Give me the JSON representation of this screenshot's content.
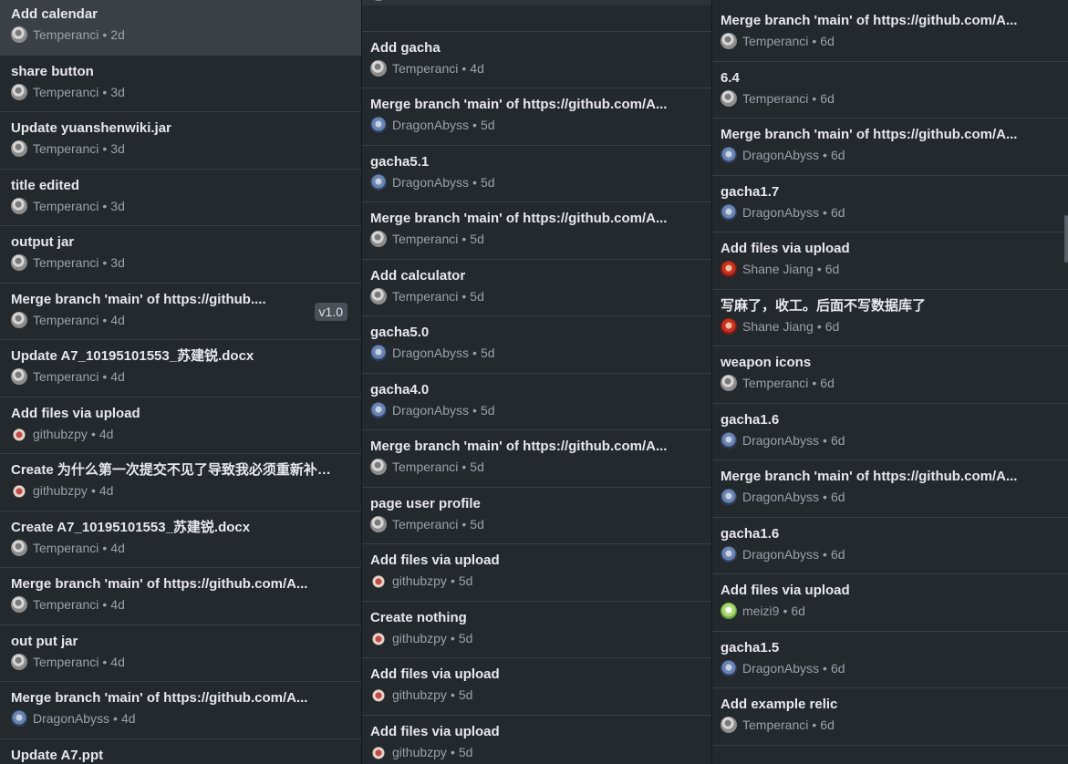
{
  "columns": [
    {
      "items": [
        {
          "title": "Add calendar",
          "author": "Temperanci",
          "time": "2d",
          "avatar": "temperanci",
          "selected": true
        },
        {
          "title": "share button",
          "author": "Temperanci",
          "time": "3d",
          "avatar": "temperanci"
        },
        {
          "title": "Update yuanshenwiki.jar",
          "author": "Temperanci",
          "time": "3d",
          "avatar": "temperanci"
        },
        {
          "title": "title edited",
          "author": "Temperanci",
          "time": "3d",
          "avatar": "temperanci"
        },
        {
          "title": "output jar",
          "author": "Temperanci",
          "time": "3d",
          "avatar": "temperanci"
        },
        {
          "title": "Merge branch 'main' of https://github....",
          "author": "Temperanci",
          "time": "4d",
          "avatar": "temperanci",
          "tag": "v1.0"
        },
        {
          "title": "Update A7_10195101553_苏建锐.docx",
          "author": "Temperanci",
          "time": "4d",
          "avatar": "temperanci"
        },
        {
          "title": "Add files via upload",
          "author": "githubzpy",
          "time": "4d",
          "avatar": "github"
        },
        {
          "title": "Create 为什么第一次提交不见了导致我必须重新补一...",
          "author": "githubzpy",
          "time": "4d",
          "avatar": "github"
        },
        {
          "title": "Create A7_10195101553_苏建锐.docx",
          "author": "Temperanci",
          "time": "4d",
          "avatar": "temperanci"
        },
        {
          "title": "Merge branch 'main' of https://github.com/A...",
          "author": "Temperanci",
          "time": "4d",
          "avatar": "temperanci"
        },
        {
          "title": "out put jar",
          "author": "Temperanci",
          "time": "4d",
          "avatar": "temperanci"
        },
        {
          "title": "Merge branch 'main' of https://github.com/A...",
          "author": "DragonAbyss",
          "time": "4d",
          "avatar": "dragon"
        },
        {
          "title": "Update A7.ppt",
          "author": "",
          "time": "",
          "avatar": ""
        }
      ]
    },
    {
      "items": [
        {
          "title": "",
          "author": "Temperanci",
          "time": "4d",
          "avatar": "temperanci"
        },
        {
          "title": "Add gacha",
          "author": "Temperanci",
          "time": "4d",
          "avatar": "temperanci"
        },
        {
          "title": "Merge branch 'main' of https://github.com/A...",
          "author": "DragonAbyss",
          "time": "5d",
          "avatar": "dragon"
        },
        {
          "title": "gacha5.1",
          "author": "DragonAbyss",
          "time": "5d",
          "avatar": "dragon"
        },
        {
          "title": "Merge branch 'main' of https://github.com/A...",
          "author": "Temperanci",
          "time": "5d",
          "avatar": "temperanci"
        },
        {
          "title": "Add calculator",
          "author": "Temperanci",
          "time": "5d",
          "avatar": "temperanci"
        },
        {
          "title": "gacha5.0",
          "author": "DragonAbyss",
          "time": "5d",
          "avatar": "dragon"
        },
        {
          "title": "gacha4.0",
          "author": "DragonAbyss",
          "time": "5d",
          "avatar": "dragon"
        },
        {
          "title": "Merge branch 'main' of https://github.com/A...",
          "author": "Temperanci",
          "time": "5d",
          "avatar": "temperanci"
        },
        {
          "title": "page user profile",
          "author": "Temperanci",
          "time": "5d",
          "avatar": "temperanci"
        },
        {
          "title": "Add files via upload",
          "author": "githubzpy",
          "time": "5d",
          "avatar": "github"
        },
        {
          "title": "Create nothing",
          "author": "githubzpy",
          "time": "5d",
          "avatar": "github"
        },
        {
          "title": "Add files via upload",
          "author": "githubzpy",
          "time": "5d",
          "avatar": "github"
        },
        {
          "title": "Add files via upload",
          "author": "githubzpy",
          "time": "5d",
          "avatar": "github"
        }
      ]
    },
    {
      "items": [
        {
          "title": "Merge branch 'main' of https://github.com/A...",
          "author": "Temperanci",
          "time": "6d",
          "avatar": "temperanci"
        },
        {
          "title": "6.4",
          "author": "Temperanci",
          "time": "6d",
          "avatar": "temperanci"
        },
        {
          "title": "Merge branch 'main' of https://github.com/A...",
          "author": "DragonAbyss",
          "time": "6d",
          "avatar": "dragon"
        },
        {
          "title": "gacha1.7",
          "author": "DragonAbyss",
          "time": "6d",
          "avatar": "dragon"
        },
        {
          "title": "Add files via upload",
          "author": "Shane Jiang",
          "time": "6d",
          "avatar": "shane"
        },
        {
          "title": "写麻了，收工。后面不写数据库了",
          "author": "Shane Jiang",
          "time": "6d",
          "avatar": "shane"
        },
        {
          "title": "weapon icons",
          "author": "Temperanci",
          "time": "6d",
          "avatar": "temperanci"
        },
        {
          "title": "gacha1.6",
          "author": "DragonAbyss",
          "time": "6d",
          "avatar": "dragon"
        },
        {
          "title": "Merge branch 'main' of https://github.com/A...",
          "author": "DragonAbyss",
          "time": "6d",
          "avatar": "dragon"
        },
        {
          "title": "gacha1.6",
          "author": "DragonAbyss",
          "time": "6d",
          "avatar": "dragon"
        },
        {
          "title": "Add files via upload",
          "author": "meizi9",
          "time": "6d",
          "avatar": "meizi"
        },
        {
          "title": "gacha1.5",
          "author": "DragonAbyss",
          "time": "6d",
          "avatar": "dragon"
        },
        {
          "title": "Add example relic",
          "author": "Temperanci",
          "time": "6d",
          "avatar": "temperanci"
        }
      ]
    }
  ],
  "separator": "•"
}
